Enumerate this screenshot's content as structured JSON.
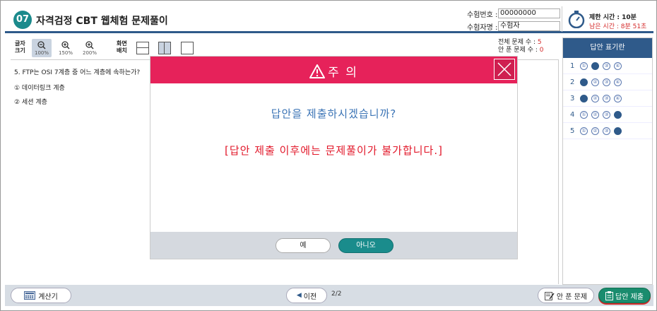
{
  "header": {
    "badge": "07",
    "title": "자격검정 CBT 웹체험 문제풀이",
    "exam_number_label": "수험번호 :",
    "exam_number_value": "00000000",
    "examinee_label": "수험자명 :",
    "examinee_value": "수험자",
    "time_limit": "제한 시간 : 10분",
    "time_remaining": "남은 시간 : 8분 51초"
  },
  "toolbar": {
    "font_size_label_1": "글자",
    "font_size_label_2": "크기",
    "zoom_levels": [
      "100%",
      "150%",
      "200%"
    ],
    "screen_layout_label_1": "화면",
    "screen_layout_label_2": "배치",
    "total_questions_label": "전체 문제 수 :",
    "total_questions_value": "5",
    "unsolved_label": "안 푼 문제 수 :",
    "unsolved_value": "0"
  },
  "question": {
    "text": "5. FTP는 OSI 7계층 중 어느 계층에 속하는가?",
    "choice_1": "① 데이터링크 계층",
    "choice_2": "② 세션 계층"
  },
  "answer_panel": {
    "title": "답안 표기란",
    "rows": [
      {
        "num": "1",
        "options": [
          "①",
          "②",
          "③",
          "④"
        ],
        "selected": 2
      },
      {
        "num": "2",
        "options": [
          "①",
          "②",
          "③",
          "④"
        ],
        "selected": 1
      },
      {
        "num": "3",
        "options": [
          "①",
          "②",
          "③",
          "④"
        ],
        "selected": 1
      },
      {
        "num": "4",
        "options": [
          "①",
          "②",
          "③",
          "④"
        ],
        "selected": 4
      },
      {
        "num": "5",
        "options": [
          "①",
          "②",
          "③",
          "④"
        ],
        "selected": 4
      }
    ]
  },
  "bottom": {
    "calc_label": "계산기",
    "prev_label": "이전",
    "page_indicator": "2/2",
    "unsolved_label": "안 푼 문제",
    "submit_label": "답안 제출"
  },
  "modal": {
    "title": "주 의",
    "question": "답안을 제출하시겠습니까?",
    "warning": "[답안 제출 이후에는 문제풀이가 불가합니다.]",
    "yes_label": "예",
    "no_label": "아니오"
  },
  "colors": {
    "accent": "#2f5a8a",
    "modal_header": "#e6225a",
    "warning_text": "#e2182a",
    "question_text": "#3a73b5",
    "submit_green": "#1a8c6e"
  }
}
